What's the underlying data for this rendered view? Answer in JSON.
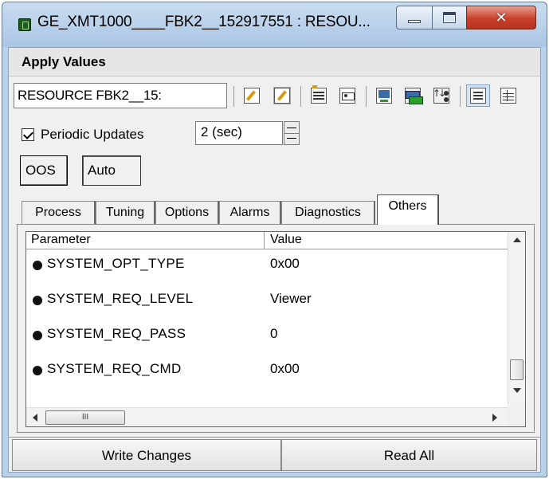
{
  "window": {
    "title": "GE_XMT1000____FBK2__152917551 : RESOU...",
    "controls": {
      "minimize": "minimize-icon",
      "maximize": "maximize-icon",
      "close": "close-icon"
    }
  },
  "menu": {
    "items": [
      "Apply Values"
    ]
  },
  "toolbar": {
    "resource_value": "RESOURCE      FBK2__15:",
    "icons": [
      "edit-icon",
      "edit-selected-icon",
      "tabs-icon",
      "card-icon",
      "monitor-icon",
      "transfer-icon",
      "sort-icon",
      "list-view-icon",
      "grid-view-icon"
    ]
  },
  "periodic": {
    "label": "Periodic Updates",
    "checked": true,
    "interval": "2 (sec)"
  },
  "mode": {
    "oos": "OOS",
    "auto": "Auto"
  },
  "tabs": [
    "Process",
    "Tuning",
    "Options",
    "Alarms",
    "Diagnostics",
    "Others"
  ],
  "active_tab": "Others",
  "table": {
    "headers": {
      "parameter": "Parameter",
      "value": "Value"
    },
    "rows": [
      {
        "parameter": "SYSTEM_OPT_TYPE",
        "value": "0x00"
      },
      {
        "parameter": "SYSTEM_REQ_LEVEL",
        "value": "Viewer"
      },
      {
        "parameter": "SYSTEM_REQ_PASS",
        "value": "0"
      },
      {
        "parameter": "SYSTEM_REQ_CMD",
        "value": "0x00"
      }
    ],
    "hscroll_thumb_glyph": "III"
  },
  "buttons": {
    "write": "Write Changes",
    "read": "Read All"
  },
  "colors": {
    "titlebar": "#b9d1ea",
    "close": "#c9402a",
    "client": "#f0f0f0"
  }
}
